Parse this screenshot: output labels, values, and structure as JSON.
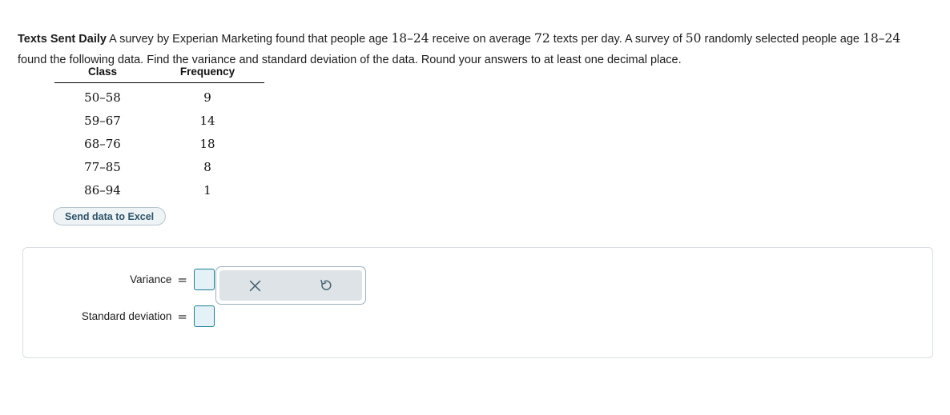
{
  "problem": {
    "lead": "Texts Sent Daily",
    "segments": [
      {
        "type": "text",
        "value": " A survey by Experian Marketing found that people age "
      },
      {
        "type": "math",
        "value": "18–24"
      },
      {
        "type": "text",
        "value": " receive on average "
      },
      {
        "type": "math",
        "value": "72"
      },
      {
        "type": "text",
        "value": " texts per day. A survey of "
      },
      {
        "type": "math",
        "value": "50"
      },
      {
        "type": "text",
        "value": " randomly selected people age "
      },
      {
        "type": "math",
        "value": "18–24"
      },
      {
        "type": "text",
        "value": " found the following data. Find the variance and standard deviation of the data. Round your answers to at least one decimal place."
      }
    ]
  },
  "table": {
    "headers": [
      "Class",
      "Frequency"
    ],
    "rows": [
      {
        "class": "50–58",
        "frequency": "9"
      },
      {
        "class": "59–67",
        "frequency": "14"
      },
      {
        "class": "68–76",
        "frequency": "18"
      },
      {
        "class": "77–85",
        "frequency": "8"
      },
      {
        "class": "86–94",
        "frequency": "1"
      }
    ]
  },
  "buttons": {
    "send_to_excel": "Send data to Excel"
  },
  "answers": {
    "variance": {
      "label": "Variance",
      "equals": "=",
      "value": ""
    },
    "standard_deviation": {
      "label": "Standard deviation",
      "equals": "=",
      "value": ""
    }
  },
  "toolbar": {
    "clear_icon": "close-x-icon",
    "undo_icon": "undo-circular-arrow-icon"
  },
  "colors": {
    "input_border": "#1a7f93",
    "input_fill": "#e4f2f7",
    "excel_button_fill": "#eef3f6",
    "excel_button_text": "#2f5468",
    "toolbar_inner": "#dde3e6",
    "toolbar_icon": "#3f5b6b",
    "panel_border": "#d8dee2"
  }
}
